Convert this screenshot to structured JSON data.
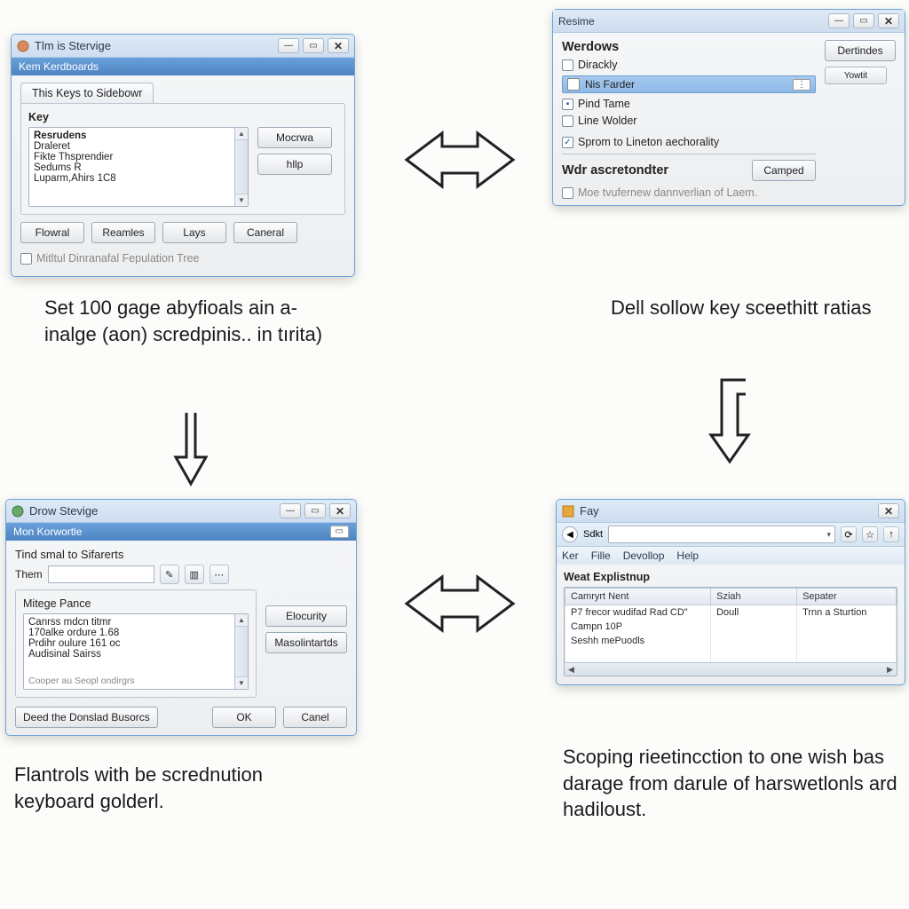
{
  "dlg1": {
    "title": "Tlm is Stervige",
    "subheader": "Kem Kerdboards",
    "tab": "This Keys to Sidebowr",
    "key_label": "Key",
    "list_header": "Resrudens",
    "list": [
      "Draleret",
      "Fikte Thsprendier",
      "Sedums R",
      "Luparm,Ahirs 1C8"
    ],
    "btn_right1": "Mocrwa",
    "btn_right2": "hllp",
    "btn_bottom": [
      "Flowral",
      "Reamles",
      "Lays",
      "Caneral"
    ],
    "footer_chk": "Mitltul Dinranafal Fepulation Tree"
  },
  "caption1": "Set 100 gage abyfioals ain a-inalge (aon) scredpinis.. in tırita)",
  "dlg2": {
    "title": "Drow Stevige",
    "subheader": "Mon Korwortle",
    "sub_label": "Tind smal to Sifarerts",
    "them_label": "Them",
    "group_label": "Mitege Pance",
    "list": [
      "Canrss mdcn titmr",
      "170alke ordure 1.68",
      "Prdihr oulure 161 oc",
      "Audisinal Sairss"
    ],
    "list_footer": "Cooper au Seopl ondirgrs",
    "btn_right1": "Elocurity",
    "btn_right2": "Masolintartds",
    "btn_footer_left": "Deed the Donslad Busorcs",
    "btn_ok": "OK",
    "btn_cancel": "Canel"
  },
  "caption3": "Flantrols with be scrednution keyboard golderl.",
  "res": {
    "title": "Resime",
    "heading": "Werdows",
    "opt1": "Dirackly",
    "opt2": "Nis Farder",
    "opt3": "Pind Tame",
    "opt4": "Line Wolder",
    "chk5": "Sprom to Lineton aechorality",
    "btn_right1": "Dertindes",
    "btn_right2": "Yowtit",
    "heading2": "Wdr ascretondter",
    "btn_camped": "Camped",
    "footer_chk": "Moe tvufernew dannverlian of Laem."
  },
  "caption2": "Dell sollow key sceethitt ratias",
  "fey": {
    "title": "Fay",
    "toolbar_label": "Sdkt",
    "menu": [
      "Ker",
      "Fille",
      "Devollop",
      "Help"
    ],
    "grid_title": "Weat Explistnup",
    "cols": [
      "Camryrt Nent",
      "Sziah",
      "Sepater"
    ],
    "rows": [
      [
        "P7 frecor wudifad Rad CD\"",
        "Doull",
        "Trnn a Sturtion"
      ],
      [
        "Campn 10P",
        "",
        ""
      ],
      [
        "Seshh mePuodls",
        "",
        ""
      ]
    ]
  },
  "caption4": "Scoping rieetincction to one wish bas darage from darule of harswetlonls ard hadiloust."
}
